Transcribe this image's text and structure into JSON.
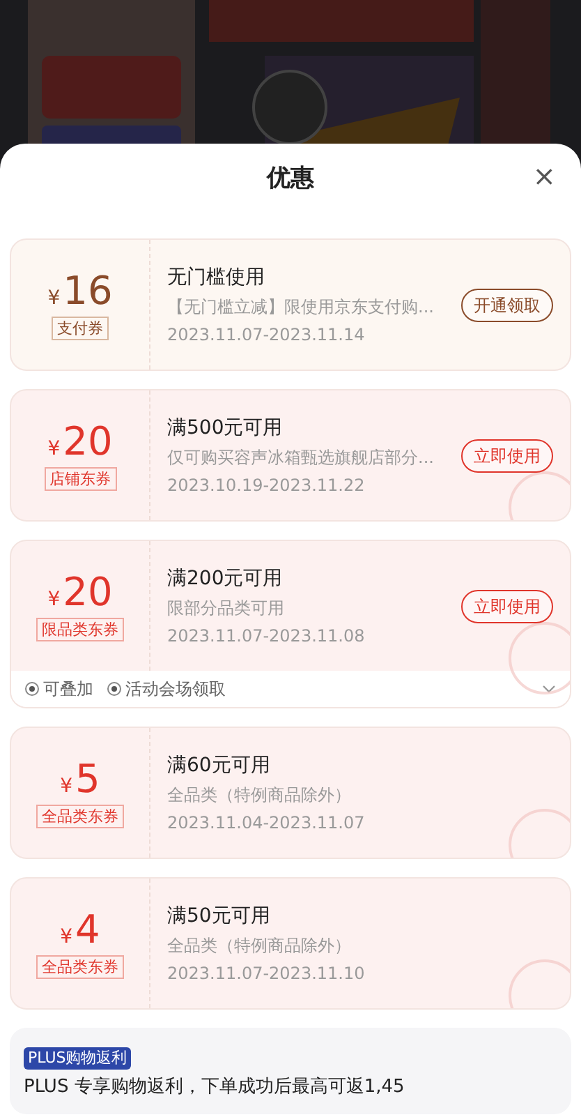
{
  "sheet": {
    "title": "优惠",
    "close": "×"
  },
  "coupons": [
    {
      "kind": "pay",
      "amount": "16",
      "currency": "¥",
      "tag": "支付券",
      "title": "无门槛使用",
      "desc": "【无门槛立减】限使用京东支付购...",
      "dates": "2023.11.07-2023.11.14",
      "button": "开通领取",
      "claimed": false
    },
    {
      "kind": "shop",
      "amount": "20",
      "currency": "¥",
      "tag": "店铺东券",
      "title": "满500元可用",
      "desc": "仅可购买容声冰箱甄选旗舰店部分...",
      "dates": "2023.10.19-2023.11.22",
      "button": "立即使用",
      "claimed": true
    },
    {
      "kind": "shop",
      "amount": "20",
      "currency": "¥",
      "tag": "限品类东券",
      "title": "满200元可用",
      "desc": "限部分品类可用",
      "dates": "2023.11.07-2023.11.08",
      "button": "立即使用",
      "claimed": true,
      "footer": {
        "stackable": "可叠加",
        "source": "活动会场领取"
      }
    },
    {
      "kind": "shop",
      "amount": "5",
      "currency": "¥",
      "tag": "全品类东券",
      "title": "满60元可用",
      "desc": "全品类（特例商品除外）",
      "dates": "2023.11.04-2023.11.07",
      "claimed": true
    },
    {
      "kind": "shop",
      "amount": "4",
      "currency": "¥",
      "tag": "全品类东券",
      "title": "满50元可用",
      "desc": "全品类（特例商品除外）",
      "dates": "2023.11.07-2023.11.10",
      "claimed": true
    }
  ],
  "plus": {
    "badge": "PLUS购物返利",
    "text": "PLUS 专享购物返利，下单成功后最高可返1,45"
  }
}
